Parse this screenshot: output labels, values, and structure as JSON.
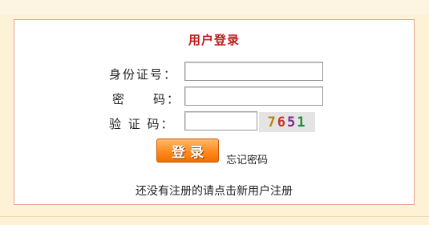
{
  "form": {
    "title": "用户登录",
    "id_label": "身份证号：",
    "password_label": "密　　码：",
    "captcha_label": "验 证 码：",
    "id_value": "",
    "password_value": "",
    "captcha_value": "",
    "captcha_image_text": [
      "7",
      "6",
      "5",
      "1"
    ],
    "login_button": "登录",
    "forgot_link": "忘记密码",
    "register_link": "还没有注册的请点击新用户注册"
  },
  "colors": {
    "title": "#c11a1a",
    "page_background": "#fdf2d6",
    "panel_border": "#e8a08e",
    "button": "#ff8a1e"
  }
}
